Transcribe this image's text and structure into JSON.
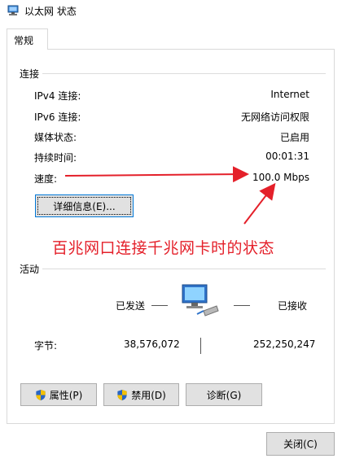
{
  "window": {
    "title": "以太网 状态"
  },
  "tabs": [
    {
      "label": "常规"
    }
  ],
  "connection": {
    "heading": "连接",
    "rows": [
      {
        "label": "IPv4 连接:",
        "value": "Internet"
      },
      {
        "label": "IPv6 连接:",
        "value": "无网络访问权限"
      },
      {
        "label": "媒体状态:",
        "value": "已启用"
      },
      {
        "label": "持续时间:",
        "value": "00:01:31"
      },
      {
        "label": "速度:",
        "value": "100.0 Mbps"
      }
    ],
    "details_button": "详细信息(E)..."
  },
  "annotation": {
    "text": "百兆网口连接千兆网卡时的状态",
    "color": "#e4202a"
  },
  "activity": {
    "heading": "活动",
    "sent_label": "已发送",
    "received_label": "已接收",
    "bytes_label": "字节:",
    "bytes_sent": "38,576,072",
    "bytes_received": "252,250,247"
  },
  "buttons": {
    "properties": "属性(P)",
    "disable": "禁用(D)",
    "diagnose": "诊断(G)",
    "close": "关闭(C)"
  },
  "icons": {
    "title": "network-adapter-icon",
    "activity": "network-computer-icon",
    "shield": "uac-shield-icon"
  },
  "colors": {
    "accent": "#0078d7",
    "annotation": "#e4202a"
  }
}
